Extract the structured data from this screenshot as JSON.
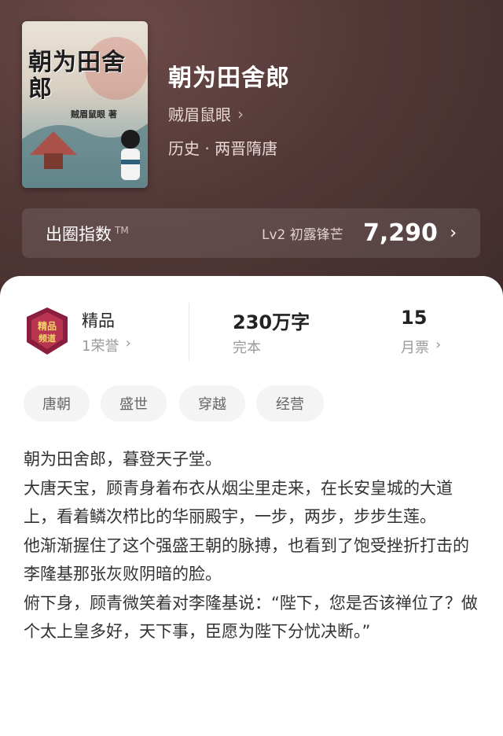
{
  "book": {
    "title": "朝为田舍郎",
    "author": "贼眉鼠眼",
    "genre": "历史 · 两晋隋唐",
    "cover": {
      "title": "朝为田舍郎",
      "author_label": "贼眉鼠眼 著"
    }
  },
  "index_bar": {
    "label": "出圈指数",
    "tm": "TM",
    "level": "Lv2 初露锋芒",
    "value": "7,290"
  },
  "stats": {
    "quality": {
      "title": "精品",
      "sub": "1荣誉"
    },
    "words": {
      "title": "230万字",
      "sub": "完本"
    },
    "tickets": {
      "title": "15",
      "sub": "月票"
    }
  },
  "tags": [
    "唐朝",
    "盛世",
    "穿越",
    "经营"
  ],
  "description": [
    "朝为田舍郎，暮登天子堂。",
    "大唐天宝，顾青身着布衣从烟尘里走来，在长安皇城的大道上，看着鳞次栉比的华丽殿宇，一步，两步，步步生莲。",
    "他渐渐握住了这个强盛王朝的脉搏，也看到了饱受挫折打击的李隆基那张灰败阴暗的脸。",
    "俯下身，顾青微笑着对李隆基说：“陛下，您是否该禅位了？做个太上皇多好，天下事，臣愿为陛下分忧决断。”"
  ],
  "colors": {
    "hero_bg": "#4a3232",
    "card_bg": "#ffffff",
    "tag_bg": "#f4f4f4",
    "badge": "#8b1e3f"
  },
  "icons": [
    "chevron-right-icon",
    "quality-badge-icon"
  ]
}
